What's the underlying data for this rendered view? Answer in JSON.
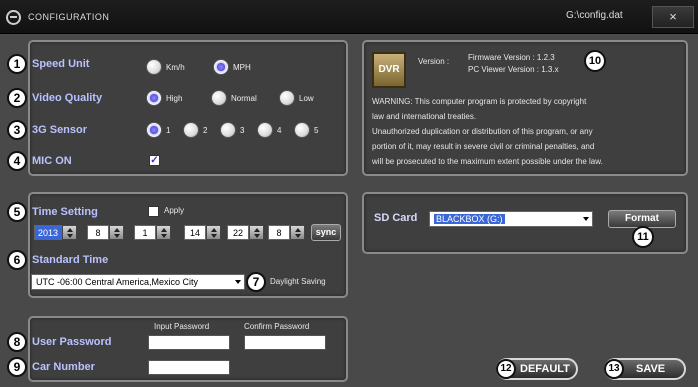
{
  "window": {
    "title": "CONFIGURATION",
    "file_path": "G:\\config.dat",
    "close_label": "×"
  },
  "badges": [
    "1",
    "2",
    "3",
    "4",
    "5",
    "6",
    "7",
    "8",
    "9",
    "10",
    "11",
    "12",
    "13"
  ],
  "settings": {
    "speed_unit": {
      "label": "Speed Unit",
      "options": [
        "Km/h",
        "MPH"
      ],
      "selected": "MPH"
    },
    "video_quality": {
      "label": "Video Quality",
      "options": [
        "High",
        "Normal",
        "Low"
      ],
      "selected": "High"
    },
    "g_sensor": {
      "label": "3G Sensor",
      "options": [
        "1",
        "2",
        "3",
        "4",
        "5"
      ],
      "selected": "1"
    },
    "mic": {
      "label": "MIC ON",
      "checked": true,
      "check_glyph": "✓"
    }
  },
  "time": {
    "label": "Time Setting",
    "apply_label": "Apply",
    "year": "2013",
    "month": "8",
    "day": "1",
    "hour": "14",
    "minute": "22",
    "second": "8",
    "sync_label": "sync",
    "standard_time_label": "Standard Time",
    "timezone": "UTC -06:00 Central America,Mexico City",
    "daylight_label": "Daylight Saving"
  },
  "user": {
    "input_password_header": "Input Password",
    "confirm_password_header": "Confirm Password",
    "password_label": "User Password",
    "car_number_label": "Car Number",
    "password_value": "",
    "confirm_value": "",
    "car_number_value": ""
  },
  "info": {
    "logo_text": "DVR",
    "version_label": "Version :",
    "firmware_version": "Firmware Version : 1.2.3",
    "pc_viewer_version": "PC Viewer Version : 1.3.x",
    "warning": [
      "WARNING: This computer program is protected by copyright",
      "law and international treaties.",
      "Unauthorized duplication or distribution of this program, or any",
      "portion of it, may result in severe civil or criminal penalties, and",
      "will be prosecuted to the maximum extent possible under the law."
    ]
  },
  "sd": {
    "label": "SD Card",
    "selected": "BLACKBOX (G:)",
    "format_label": "Format"
  },
  "actions": {
    "default_label": "DEFAULT",
    "save_label": "SAVE"
  }
}
